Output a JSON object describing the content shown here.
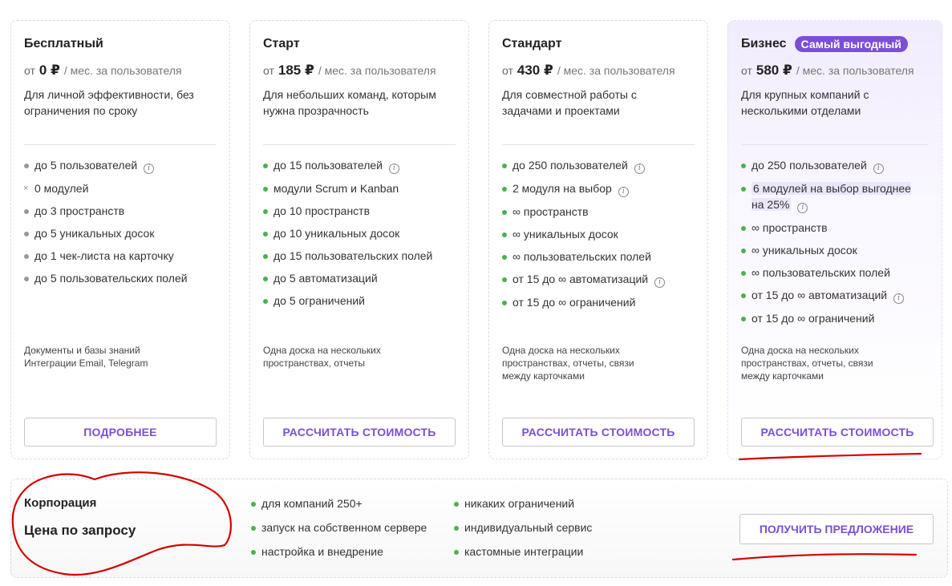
{
  "plans": [
    {
      "name": "Бесплатный",
      "price_prefix": "от",
      "price": "0 ₽",
      "price_unit": "/ мес. за пользователя",
      "description": "Для личной эффективности, без ограничения по сроку",
      "features": [
        {
          "text": "до 5 пользователей",
          "info": "i",
          "marker": "gray"
        },
        {
          "text": "0 модулей",
          "marker": "cross",
          "cross": "×"
        },
        {
          "text": "до 3 пространств",
          "marker": "gray"
        },
        {
          "text": "до 5 уникальных досок",
          "marker": "gray"
        },
        {
          "text": "до 1 чек-листа на карточку",
          "marker": "gray"
        },
        {
          "text": "до 5 пользовательских полей",
          "marker": "gray"
        }
      ],
      "extra": [
        "Документы и базы знаний",
        "Интеграции Email, Telegram"
      ],
      "button": "ПОДРОБНЕЕ"
    },
    {
      "name": "Старт",
      "price_prefix": "от",
      "price": "185 ₽",
      "price_unit": "/ мес. за пользователя",
      "description": "Для небольших команд, которым нужна прозрачность",
      "features": [
        {
          "text": "до 15 пользователей",
          "info": "i"
        },
        {
          "text": "модули Scrum и Kanban"
        },
        {
          "text": "до 10 пространств"
        },
        {
          "text": "до 10 уникальных досок"
        },
        {
          "text": "до 15 пользовательских полей"
        },
        {
          "text": "до 5 автоматизаций"
        },
        {
          "text": "до 5 ограничений"
        }
      ],
      "extra": [
        "Одна доска на нескольких",
        "пространствах, отчеты"
      ],
      "button": "РАССЧИТАТЬ СТОИМОСТЬ"
    },
    {
      "name": "Стандарт",
      "price_prefix": "от",
      "price": "430 ₽",
      "price_unit": "/ мес. за пользователя",
      "description": "Для совместной работы с задачами и проектами",
      "features": [
        {
          "text": "до 250 пользователей",
          "info": "i"
        },
        {
          "text": "2 модуля на выбор",
          "info": "i"
        },
        {
          "text": "∞ пространств"
        },
        {
          "text": "∞ уникальных досок"
        },
        {
          "text": "∞ пользовательских полей"
        },
        {
          "text": "от 15 до ∞ автоматизаций",
          "info": "i"
        },
        {
          "text": "от 15 до ∞ ограничений"
        }
      ],
      "extra": [
        "Одна доска на нескольких",
        "пространствах, отчеты, связи",
        "между карточками"
      ],
      "button": "РАССЧИТАТЬ СТОИМОСТЬ"
    },
    {
      "name": "Бизнес",
      "badge": "Самый выгодный",
      "price_prefix": "от",
      "price": "580 ₽",
      "price_unit": "/ мес. за пользователя",
      "description": "Для крупных компаний с несколькими отделами",
      "features": [
        {
          "text": "до 250 пользователей",
          "info": "i"
        },
        {
          "text": "6 модулей на выбор выгоднее на 25%",
          "info": "i",
          "highlight": true
        },
        {
          "text": "∞ пространств"
        },
        {
          "text": "∞ уникальных досок"
        },
        {
          "text": "∞ пользовательских полей"
        },
        {
          "text": "от 15 до ∞ автоматизаций",
          "info": "i"
        },
        {
          "text": "от 15 до ∞ ограничений"
        }
      ],
      "extra": [
        "Одна доска на нескольких",
        "пространствах, отчеты, связи",
        "между карточками"
      ],
      "button": "РАССЧИТАТЬ СТОИМОСТЬ"
    }
  ],
  "corporate": {
    "title": "Корпорация",
    "price": "Цена по запросу",
    "features_col1": [
      "для компаний 250+",
      "запуск на собственном сервере",
      "настройка и внедрение"
    ],
    "features_col2": [
      "никаких ограничений",
      "индивидуальный сервис",
      "кастомные интеграции"
    ],
    "button": "ПОЛУЧИТЬ ПРЕДЛОЖЕНИЕ"
  },
  "colors": {
    "accent": "#7a4fd4",
    "badge": "#7b4fd6",
    "bullet": "#4caf50",
    "annotation": "#d40000"
  }
}
